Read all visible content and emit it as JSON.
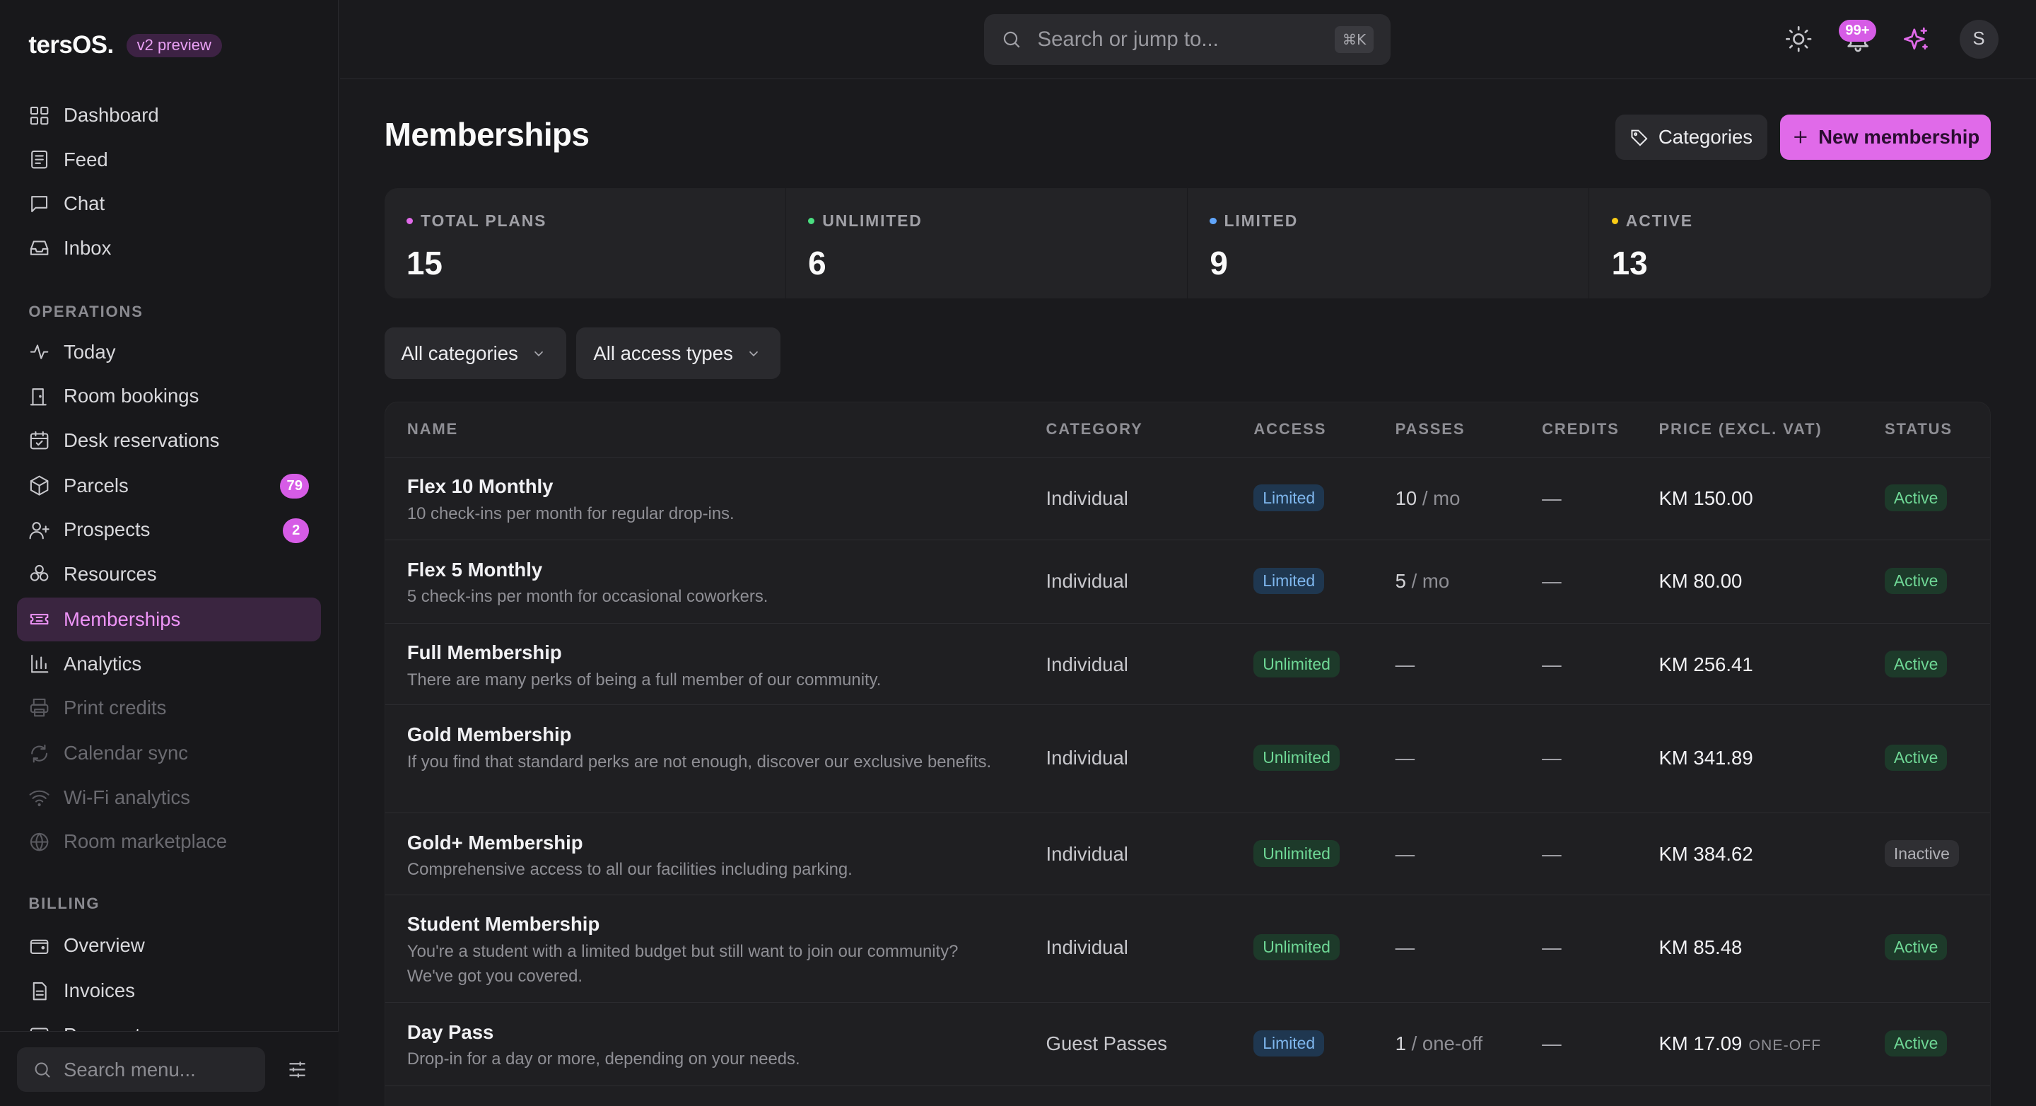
{
  "brand": {
    "name": "tersOS.",
    "badge": "v2 preview"
  },
  "sidebar": {
    "items": [
      {
        "label": "Dashboard",
        "icon": "grid-icon"
      },
      {
        "label": "Feed",
        "icon": "newspaper-icon"
      },
      {
        "label": "Chat",
        "icon": "chat-icon"
      },
      {
        "label": "Inbox",
        "icon": "inbox-icon"
      }
    ],
    "section_operations": "OPERATIONS",
    "operations": [
      {
        "label": "Today",
        "icon": "pulse-icon"
      },
      {
        "label": "Room bookings",
        "icon": "door-icon"
      },
      {
        "label": "Desk reservations",
        "icon": "calendar-check-icon"
      },
      {
        "label": "Parcels",
        "icon": "package-icon",
        "badge": "79"
      },
      {
        "label": "Prospects",
        "icon": "user-plus-icon",
        "badge": "2"
      },
      {
        "label": "Resources",
        "icon": "resources-icon"
      },
      {
        "label": "Memberships",
        "icon": "ticket-icon",
        "active": true
      },
      {
        "label": "Analytics",
        "icon": "bar-chart-icon"
      },
      {
        "label": "Print credits",
        "icon": "printer-icon",
        "disabled": true
      },
      {
        "label": "Calendar sync",
        "icon": "refresh-icon",
        "disabled": true
      },
      {
        "label": "Wi-Fi analytics",
        "icon": "wifi-icon",
        "disabled": true
      },
      {
        "label": "Room marketplace",
        "icon": "globe-icon",
        "disabled": true
      }
    ],
    "section_billing": "BILLING",
    "billing": [
      {
        "label": "Overview",
        "icon": "wallet-icon"
      },
      {
        "label": "Invoices",
        "icon": "invoice-icon"
      },
      {
        "label": "Payments",
        "icon": "card-icon"
      }
    ],
    "search_placeholder": "Search menu..."
  },
  "topbar": {
    "search_placeholder": "Search or jump to...",
    "shortcut": "⌘K",
    "notifications": "99+",
    "avatar": "S"
  },
  "page": {
    "title": "Memberships",
    "categories_button": "Categories",
    "new_button": "New membership"
  },
  "stats": [
    {
      "label": "TOTAL PLANS",
      "value": "15",
      "color": "#e06ae9"
    },
    {
      "label": "UNLIMITED",
      "value": "6",
      "color": "#4ade80"
    },
    {
      "label": "LIMITED",
      "value": "9",
      "color": "#60a5fa"
    },
    {
      "label": "ACTIVE",
      "value": "13",
      "color": "#facc15"
    }
  ],
  "filters": {
    "category": "All categories",
    "access": "All access types"
  },
  "table": {
    "headers": {
      "name": "NAME",
      "category": "CATEGORY",
      "access": "ACCESS",
      "passes": "PASSES",
      "credits": "CREDITS",
      "price": "PRICE (EXCL. VAT)",
      "status": "STATUS"
    },
    "rows": [
      {
        "name": "Flex 10 Monthly",
        "desc": "10 check-ins per month for regular drop-ins.",
        "category": "Individual",
        "access": "Limited",
        "passes": "10",
        "passes_unit": "/ mo",
        "credits": "—",
        "price": "KM 150.00",
        "price_note": "",
        "status": "Active"
      },
      {
        "name": "Flex 5 Monthly",
        "desc": "5 check-ins per month for occasional coworkers.",
        "category": "Individual",
        "access": "Limited",
        "passes": "5",
        "passes_unit": "/ mo",
        "credits": "—",
        "price": "KM 80.00",
        "price_note": "",
        "status": "Active"
      },
      {
        "name": "Full Membership",
        "desc": "There are many perks of being a full member of our community.",
        "category": "Individual",
        "access": "Unlimited",
        "passes": "—",
        "passes_unit": "",
        "credits": "—",
        "price": "KM 256.41",
        "price_note": "",
        "status": "Active"
      },
      {
        "name": "Gold Membership",
        "desc": "If you find that standard perks are not enough, discover our exclusive benefits.",
        "category": "Individual",
        "access": "Unlimited",
        "passes": "—",
        "passes_unit": "",
        "credits": "—",
        "price": "KM 341.89",
        "price_note": "",
        "status": "Active"
      },
      {
        "name": "Gold+ Membership",
        "desc": "Comprehensive access to all our facilities including parking.",
        "category": "Individual",
        "access": "Unlimited",
        "passes": "—",
        "passes_unit": "",
        "credits": "—",
        "price": "KM 384.62",
        "price_note": "",
        "status": "Inactive"
      },
      {
        "name": "Student Membership",
        "desc": "You're a student with a limited budget but still want to join our community? We've got you covered.",
        "category": "Individual",
        "access": "Unlimited",
        "passes": "—",
        "passes_unit": "",
        "credits": "—",
        "price": "KM 85.48",
        "price_note": "",
        "status": "Active"
      },
      {
        "name": "Day Pass",
        "desc": "Drop-in for a day or more, depending on your needs.",
        "category": "Guest Passes",
        "access": "Limited",
        "passes": "1",
        "passes_unit": "/ one-off",
        "credits": "—",
        "price": "KM 17.09",
        "price_note": "ONE-OFF",
        "status": "Active"
      }
    ]
  }
}
